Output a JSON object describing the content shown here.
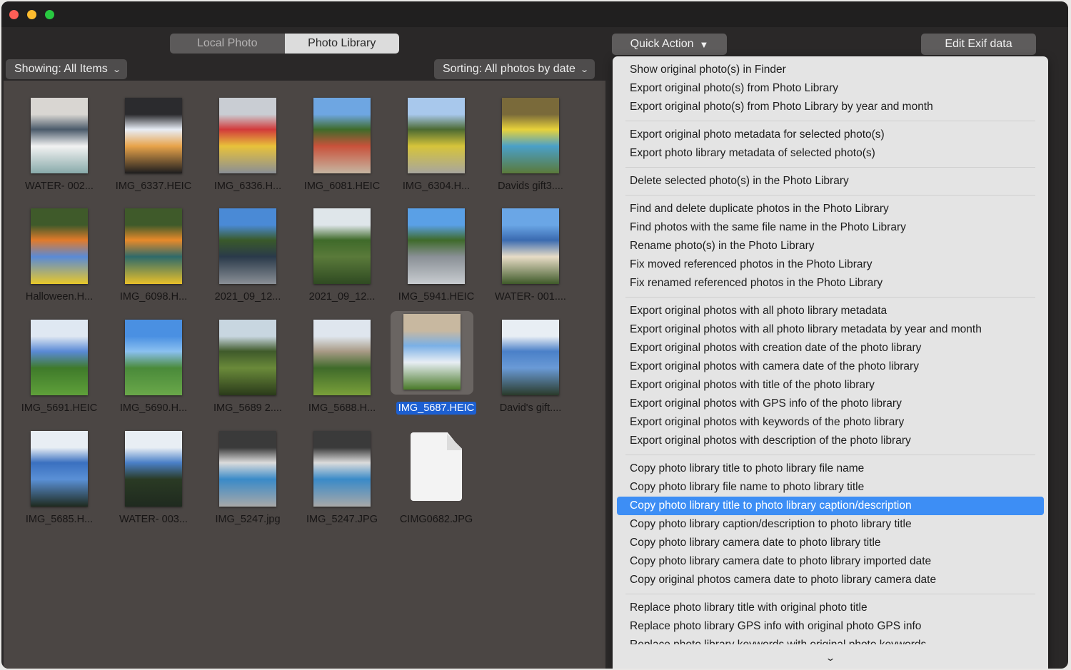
{
  "window": {
    "traffic_lights": [
      "close",
      "minimize",
      "zoom"
    ]
  },
  "source_tabs": [
    {
      "label": "Local Photo",
      "selected": false
    },
    {
      "label": "Photo Library",
      "selected": true
    }
  ],
  "toolbar": {
    "showing_label": "Showing: All Items",
    "sorting_label": "Sorting: All photos by date",
    "quick_action_label": "Quick Action",
    "edit_exif_label": "Edit Exif data",
    "dropdown_chevron": "⌄",
    "quick_action_arrow": "▼"
  },
  "photos": [
    {
      "name": "WATER- 002...",
      "colors": [
        "#d9d6d2",
        "#4a5a6a",
        "#f2f2f2",
        "#8aa"
      ],
      "kind": "photo"
    },
    {
      "name": "IMG_6337.HEIC",
      "colors": [
        "#2b2b2e",
        "#e8edf6",
        "#e8a34a",
        "#1d1d1f"
      ],
      "kind": "photo"
    },
    {
      "name": "IMG_6336.H...",
      "colors": [
        "#c9cdd3",
        "#d23a3a",
        "#e8c23a",
        "#8a8f96"
      ],
      "kind": "photo"
    },
    {
      "name": "IMG_6081.HEIC",
      "colors": [
        "#6ea6e2",
        "#3f6b2a",
        "#c9523b",
        "#c6b6a2"
      ],
      "kind": "photo"
    },
    {
      "name": "IMG_6304.H...",
      "colors": [
        "#a8c8ec",
        "#4c6a32",
        "#d6c43a",
        "#a8a69e"
      ],
      "kind": "photo"
    },
    {
      "name": "Davids gift3....",
      "colors": [
        "#7a6a3a",
        "#e8d23a",
        "#4aa0c8",
        "#5b7a3a"
      ],
      "kind": "photo"
    },
    {
      "name": "Halloween.H...",
      "colors": [
        "#3f5a2a",
        "#e27a2a",
        "#5a8ad6",
        "#e8c82a"
      ],
      "kind": "photo"
    },
    {
      "name": "IMG_6098.H...",
      "colors": [
        "#3f5a2a",
        "#e88a2a",
        "#2e6a6a",
        "#e8c02a"
      ],
      "kind": "photo"
    },
    {
      "name": "2021_09_12...",
      "colors": [
        "#4a8ad6",
        "#3a5a2a",
        "#2a3a4a",
        "#8a8f96"
      ],
      "kind": "photo"
    },
    {
      "name": "2021_09_12...",
      "colors": [
        "#dfe6ea",
        "#3f6a2a",
        "#5a7a3a",
        "#2f4a22"
      ],
      "kind": "photo"
    },
    {
      "name": "IMG_5941.HEIC",
      "colors": [
        "#5aa0e6",
        "#3f6a2a",
        "#8a9096",
        "#c8ccd0"
      ],
      "kind": "photo"
    },
    {
      "name": "WATER- 001....",
      "colors": [
        "#6aa6e6",
        "#3a6ab0",
        "#e8dcc6",
        "#3f5a2a"
      ],
      "kind": "photo"
    },
    {
      "name": "IMG_5691.HEIC",
      "colors": [
        "#dfe8f2",
        "#5a8ad6",
        "#3f7a2a",
        "#5fa03a"
      ],
      "kind": "photo"
    },
    {
      "name": "IMG_5690.H...",
      "colors": [
        "#4a90e2",
        "#8ac0f0",
        "#4a8a3a",
        "#6aa84a"
      ],
      "kind": "photo"
    },
    {
      "name": "IMG_5689 2....",
      "colors": [
        "#c8d6e0",
        "#3f5a2a",
        "#6a8a3a",
        "#2a3a1a"
      ],
      "kind": "photo"
    },
    {
      "name": "IMG_5688.H...",
      "colors": [
        "#dfe6ee",
        "#a89a86",
        "#3f6a2a",
        "#7aa03a"
      ],
      "kind": "photo"
    },
    {
      "name": "IMG_5687.HEIC",
      "colors": [
        "#c8b8a0",
        "#7ab0e6",
        "#e8eef4",
        "#4a7a2a"
      ],
      "kind": "photo",
      "selected": true
    },
    {
      "name": "David's gift....",
      "colors": [
        "#e8eef4",
        "#4a80c8",
        "#6a9ad6",
        "#2a3a2a"
      ],
      "kind": "photo"
    },
    {
      "name": "IMG_5685.H...",
      "colors": [
        "#e8eef4",
        "#3a70c0",
        "#5a90d6",
        "#1f2a1f"
      ],
      "kind": "photo"
    },
    {
      "name": "WATER- 003...",
      "colors": [
        "#e8eef4",
        "#4a80c8",
        "#2a3a24",
        "#1f2a1f"
      ],
      "kind": "photo"
    },
    {
      "name": "IMG_5247.jpg",
      "colors": [
        "#3a3a3a",
        "#dcdcdc",
        "#3a8ac8",
        "#a8a8a8"
      ],
      "kind": "photo"
    },
    {
      "name": "IMG_5247.JPG",
      "colors": [
        "#3a3a3a",
        "#dcdcdc",
        "#3a8ac8",
        "#a8a8a8"
      ],
      "kind": "photo"
    },
    {
      "name": "CIMG0682.JPG",
      "kind": "file"
    }
  ],
  "quick_action_menu": {
    "groups": [
      [
        "Show original photo(s) in Finder",
        "Export original photo(s) from Photo Library",
        "Export original photo(s) from Photo Library by year and month"
      ],
      [
        "Export original photo metadata for selected photo(s)",
        "Export photo library metadata of selected photo(s)"
      ],
      [
        "Delete selected photo(s) in the Photo Library"
      ],
      [
        "Find and delete duplicate photos in the Photo Library",
        "Find photos with the same file name in the Photo Library",
        "Rename photo(s) in the Photo Library",
        "Fix moved referenced photos in the Photo Library",
        "Fix renamed referenced photos in the Photo Library"
      ],
      [
        "Export original photos with all photo library metadata",
        "Export original photos with all photo library metadata by year and month",
        "Export original photos with creation date of the photo library",
        "Export original photos with camera date of the photo library",
        "Export original photos with title of the photo library",
        "Export original photos with GPS info of the photo library",
        "Export original photos with keywords of the photo library",
        "Export original photos with description of the photo library"
      ],
      [
        "Copy photo library title to photo library file name",
        "Copy photo library file name to photo library title",
        "Copy photo library title to photo library caption/description",
        "Copy photo library caption/description to photo library title",
        "Copy photo library camera date to photo library title",
        "Copy photo library camera date to photo library imported date",
        "Copy original photos camera date to photo library camera date"
      ],
      [
        "Replace photo library title with original photo title",
        "Replace photo library GPS info with original photo GPS info",
        "Replace photo library keywords with original photo keywords"
      ]
    ],
    "highlighted": "Copy photo library title to photo library caption/description",
    "scroll_indicator": "⌄"
  },
  "colors": {
    "selection_blue": "#1c5fd1",
    "menu_highlight": "#3d8ef5"
  }
}
